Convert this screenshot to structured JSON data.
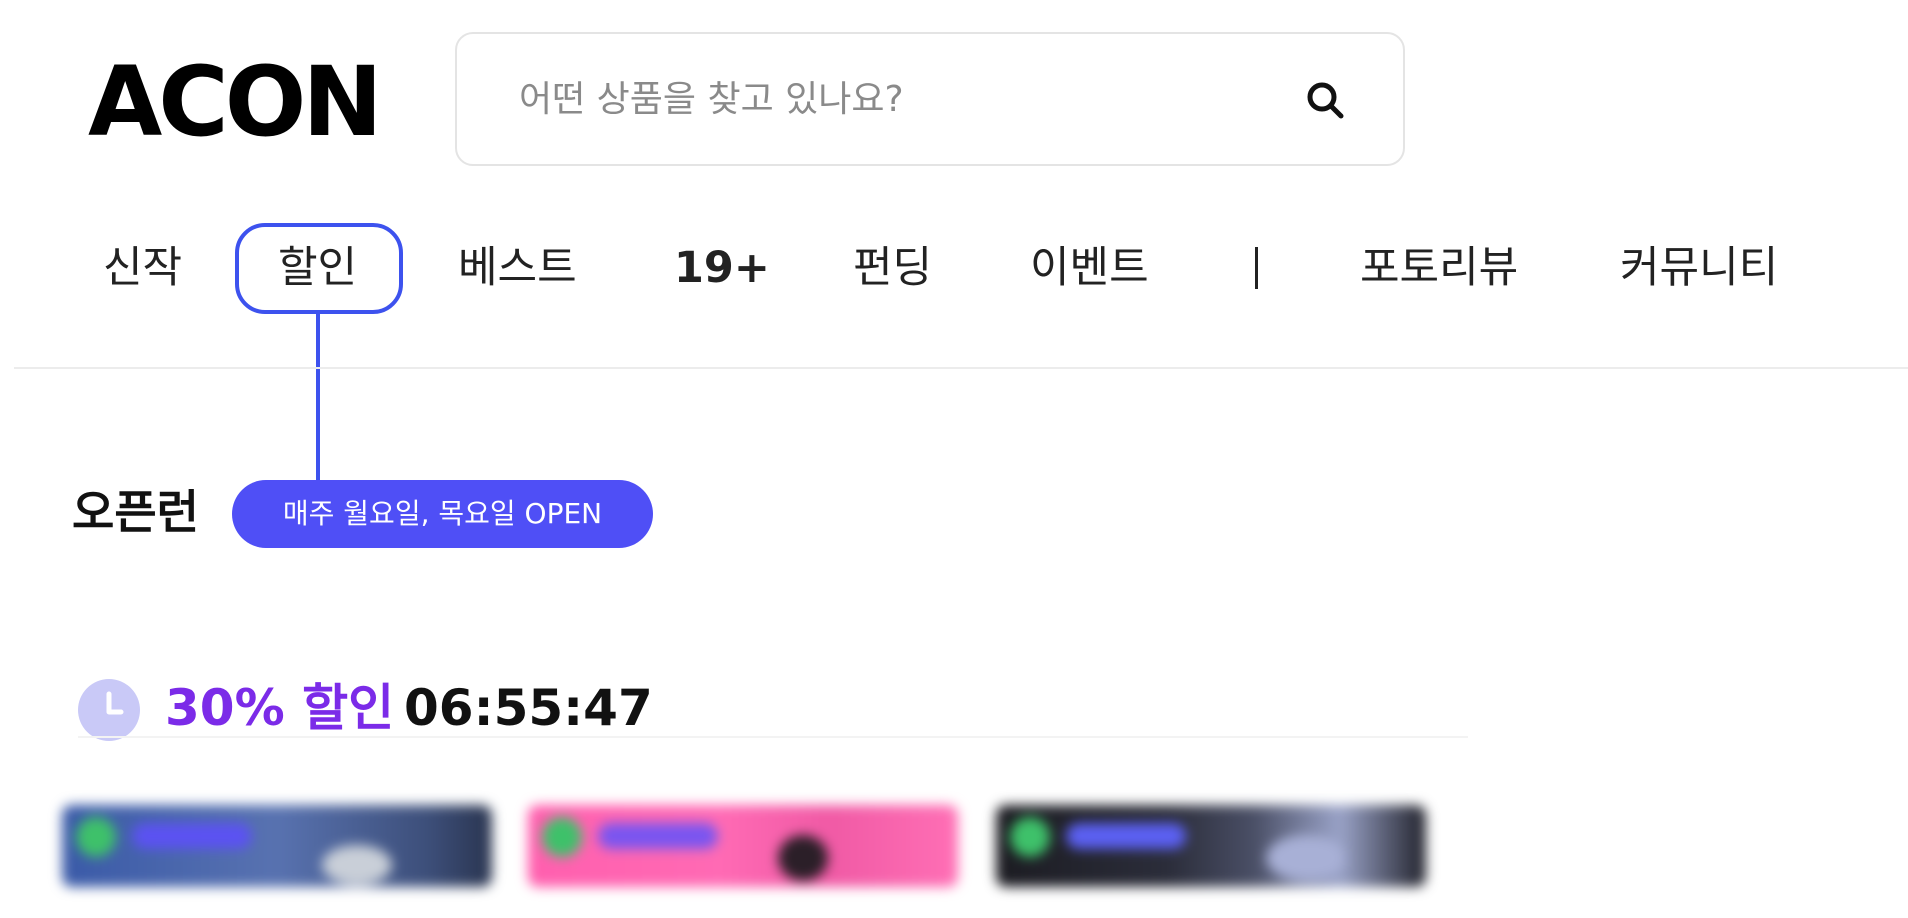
{
  "header": {
    "logo_text": "ACON",
    "search": {
      "placeholder": "어떤 상품을 찾고 있나요?",
      "value": "",
      "icon": "search-icon"
    }
  },
  "nav": {
    "items": [
      {
        "label": "신작"
      },
      {
        "label": "할인",
        "highlighted": true
      },
      {
        "label": "베스트"
      },
      {
        "label": "19+"
      },
      {
        "label": "펀딩"
      },
      {
        "label": "이벤트"
      },
      {
        "label": "포토리뷰"
      },
      {
        "label": "커뮤니티"
      }
    ],
    "separator": "|"
  },
  "section": {
    "title": "오픈런",
    "badge": "매주 월요일, 목요일 OPEN"
  },
  "discount": {
    "icon": "clock-icon",
    "label": "30% 할인",
    "timer": "06:55:47"
  },
  "colors": {
    "accent_blue": "#3d52ee",
    "badge_bg": "#4f4ff6",
    "discount_purple": "#7b2be8",
    "clock_bg": "#c9c9f7"
  }
}
